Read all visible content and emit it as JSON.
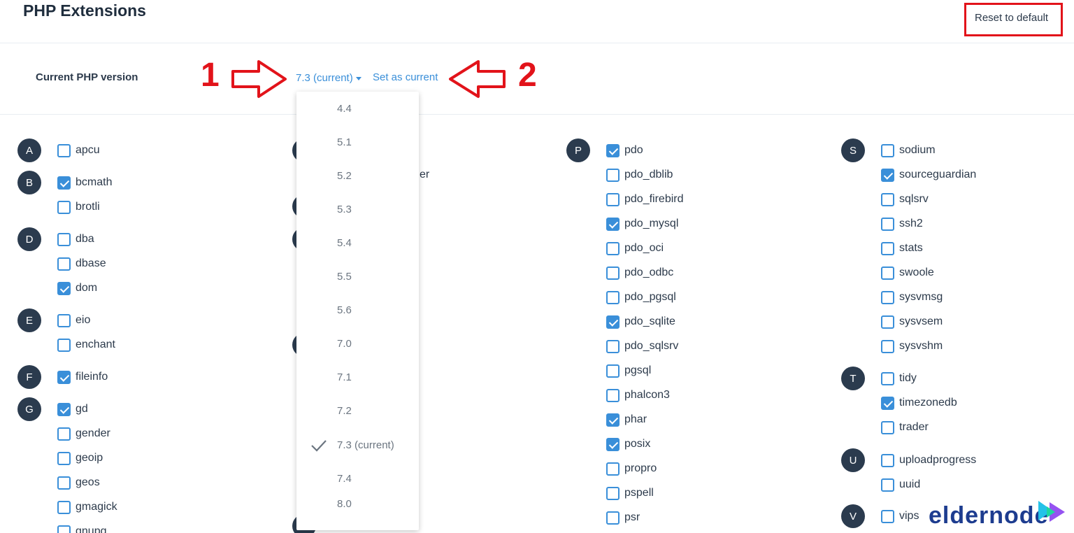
{
  "header": {
    "title": "PHP Extensions",
    "reset_label": "Reset to default"
  },
  "version": {
    "label": "Current PHP version",
    "selected": "7.3 (current)",
    "set_current": "Set as current",
    "annotation_1": "1",
    "annotation_2": "2"
  },
  "dropdown": {
    "options": [
      "4.4",
      "5.1",
      "5.2",
      "5.3",
      "5.4",
      "5.5",
      "5.6",
      "7.0",
      "7.1",
      "7.2",
      "7.3 (current)",
      "7.4",
      "8.0"
    ],
    "selected_index": 10
  },
  "columns": [
    {
      "groups": [
        {
          "letter": "A",
          "items": [
            {
              "name": "apcu",
              "checked": false
            }
          ]
        },
        {
          "letter": "B",
          "items": [
            {
              "name": "bcmath",
              "checked": true
            },
            {
              "name": "brotli",
              "checked": false
            }
          ]
        },
        {
          "letter": "D",
          "items": [
            {
              "name": "dba",
              "checked": false
            },
            {
              "name": "dbase",
              "checked": false
            },
            {
              "name": "dom",
              "checked": true
            }
          ]
        },
        {
          "letter": "E",
          "items": [
            {
              "name": "eio",
              "checked": false
            },
            {
              "name": "enchant",
              "checked": false
            }
          ]
        },
        {
          "letter": "F",
          "items": [
            {
              "name": "fileinfo",
              "checked": true
            }
          ]
        },
        {
          "letter": "G",
          "items": [
            {
              "name": "gd",
              "checked": true
            },
            {
              "name": "gender",
              "checked": false
            },
            {
              "name": "geoip",
              "checked": false
            },
            {
              "name": "geos",
              "checked": false
            },
            {
              "name": "gmagick",
              "checked": false
            },
            {
              "name": "gnupg",
              "checked": false
            }
          ]
        }
      ]
    },
    {
      "partial_text": "er"
    },
    {
      "groups": [
        {
          "letter": "P",
          "items": [
            {
              "name": "pdo",
              "checked": true
            },
            {
              "name": "pdo_dblib",
              "checked": false
            },
            {
              "name": "pdo_firebird",
              "checked": false
            },
            {
              "name": "pdo_mysql",
              "checked": true
            },
            {
              "name": "pdo_oci",
              "checked": false
            },
            {
              "name": "pdo_odbc",
              "checked": false
            },
            {
              "name": "pdo_pgsql",
              "checked": false
            },
            {
              "name": "pdo_sqlite",
              "checked": true
            },
            {
              "name": "pdo_sqlsrv",
              "checked": false
            },
            {
              "name": "pgsql",
              "checked": false
            },
            {
              "name": "phalcon3",
              "checked": false
            },
            {
              "name": "phar",
              "checked": true
            },
            {
              "name": "posix",
              "checked": true
            },
            {
              "name": "propro",
              "checked": false
            },
            {
              "name": "pspell",
              "checked": false
            },
            {
              "name": "psr",
              "checked": false
            }
          ]
        }
      ]
    },
    {
      "groups": [
        {
          "letter": "S",
          "items": [
            {
              "name": "sodium",
              "checked": false
            },
            {
              "name": "sourceguardian",
              "checked": true
            },
            {
              "name": "sqlsrv",
              "checked": false
            },
            {
              "name": "ssh2",
              "checked": false
            },
            {
              "name": "stats",
              "checked": false
            },
            {
              "name": "swoole",
              "checked": false
            },
            {
              "name": "sysvmsg",
              "checked": false
            },
            {
              "name": "sysvsem",
              "checked": false
            },
            {
              "name": "sysvshm",
              "checked": false
            }
          ]
        },
        {
          "letter": "T",
          "items": [
            {
              "name": "tidy",
              "checked": false
            },
            {
              "name": "timezonedb",
              "checked": true
            },
            {
              "name": "trader",
              "checked": false
            }
          ]
        },
        {
          "letter": "U",
          "items": [
            {
              "name": "uploadprogress",
              "checked": false
            },
            {
              "name": "uuid",
              "checked": false
            }
          ]
        },
        {
          "letter": "V",
          "items": [
            {
              "name": "vips",
              "checked": false
            }
          ]
        }
      ]
    }
  ],
  "logo": {
    "text": "eldernode",
    "colors": [
      "#1d3c8f",
      "#25c2e8",
      "#8a3ff0"
    ]
  },
  "colors": {
    "accent": "#3a8fd9",
    "annotation": "#e2131a",
    "badge": "#2b3b4e"
  }
}
